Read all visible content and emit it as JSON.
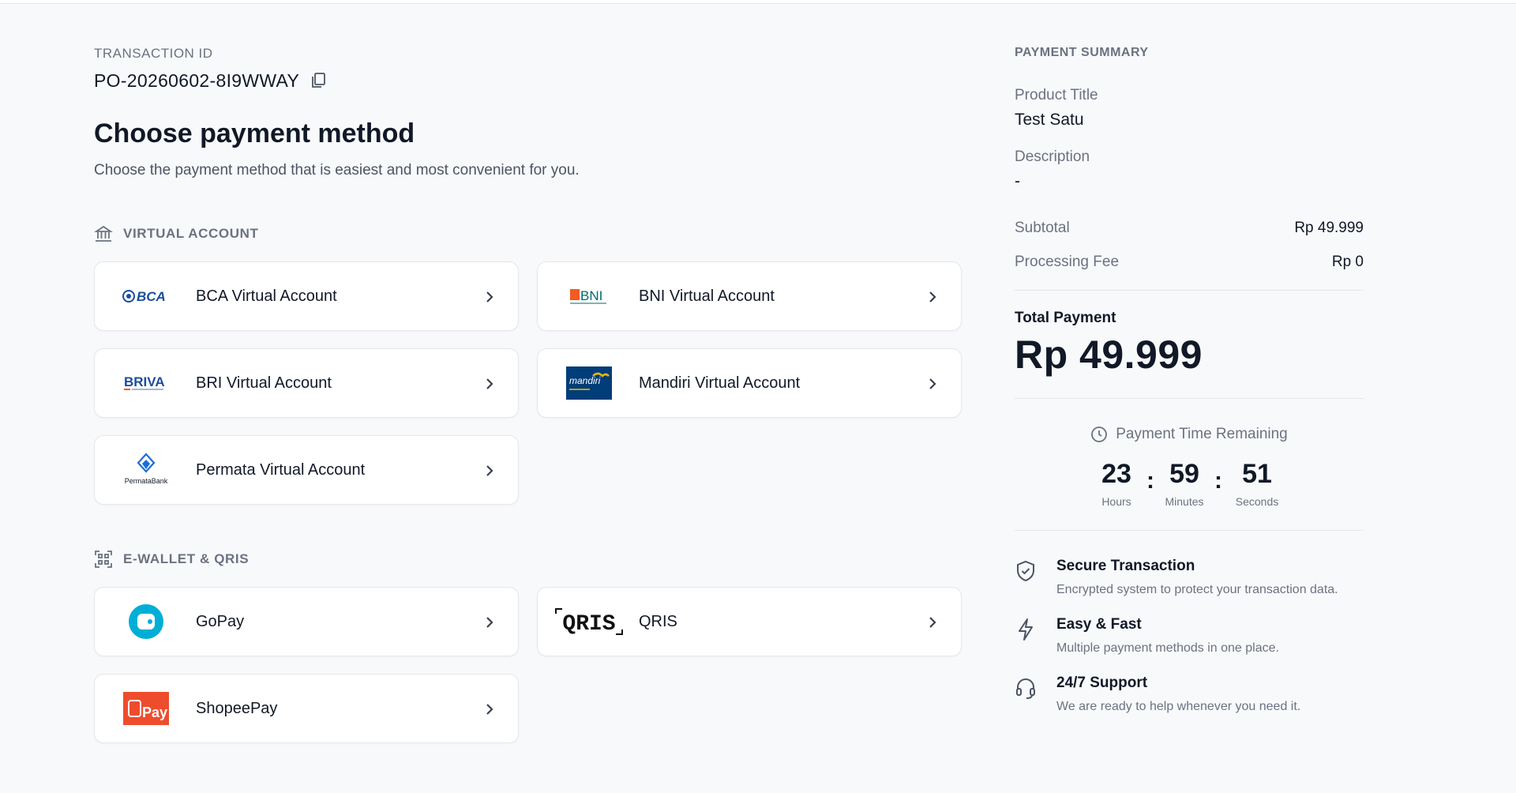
{
  "transaction": {
    "label": "TRANSACTION ID",
    "id": "PO-20260602-8I9WWAY"
  },
  "heading": {
    "title": "Choose payment method",
    "subtitle": "Choose the payment method that is easiest and most convenient for you."
  },
  "sections": {
    "virtual_account": {
      "label": "VIRTUAL ACCOUNT",
      "items": [
        {
          "label": "BCA Virtual Account",
          "logo_text": "BCA"
        },
        {
          "label": "BNI Virtual Account",
          "logo_text": "BNI"
        },
        {
          "label": "BRI Virtual Account",
          "logo_text": "BRIVA"
        },
        {
          "label": "Mandiri Virtual Account",
          "logo_text": "mandiri"
        },
        {
          "label": "Permata Virtual Account",
          "logo_text": "PermataBank"
        }
      ]
    },
    "ewallet": {
      "label": "E-WALLET & QRIS",
      "items": [
        {
          "label": "GoPay"
        },
        {
          "label": "QRIS",
          "logo_text": "QRIS"
        },
        {
          "label": "ShopeePay",
          "logo_text": "Pay"
        }
      ]
    }
  },
  "summary": {
    "label": "PAYMENT SUMMARY",
    "product_title_label": "Product Title",
    "product_title": "Test Satu",
    "description_label": "Description",
    "description": "-",
    "subtotal_label": "Subtotal",
    "subtotal": "Rp 49.999",
    "fee_label": "Processing Fee",
    "fee": "Rp 0",
    "total_label": "Total Payment",
    "total": "Rp 49.999"
  },
  "timer": {
    "title": "Payment Time Remaining",
    "hours": "23",
    "minutes": "59",
    "seconds": "51",
    "hours_label": "Hours",
    "minutes_label": "Minutes",
    "seconds_label": "Seconds",
    "separator": ":"
  },
  "features": [
    {
      "title": "Secure Transaction",
      "desc": "Encrypted system to protect your transaction data."
    },
    {
      "title": "Easy & Fast",
      "desc": "Multiple payment methods in one place."
    },
    {
      "title": "24/7 Support",
      "desc": "We are ready to help whenever you need it."
    }
  ],
  "colors": {
    "gopay": "#00aed6",
    "shopee": "#ee4d2d",
    "mandiri_bg": "#003d79",
    "bca": "#1a4c9c",
    "bni": "#f15a23"
  }
}
